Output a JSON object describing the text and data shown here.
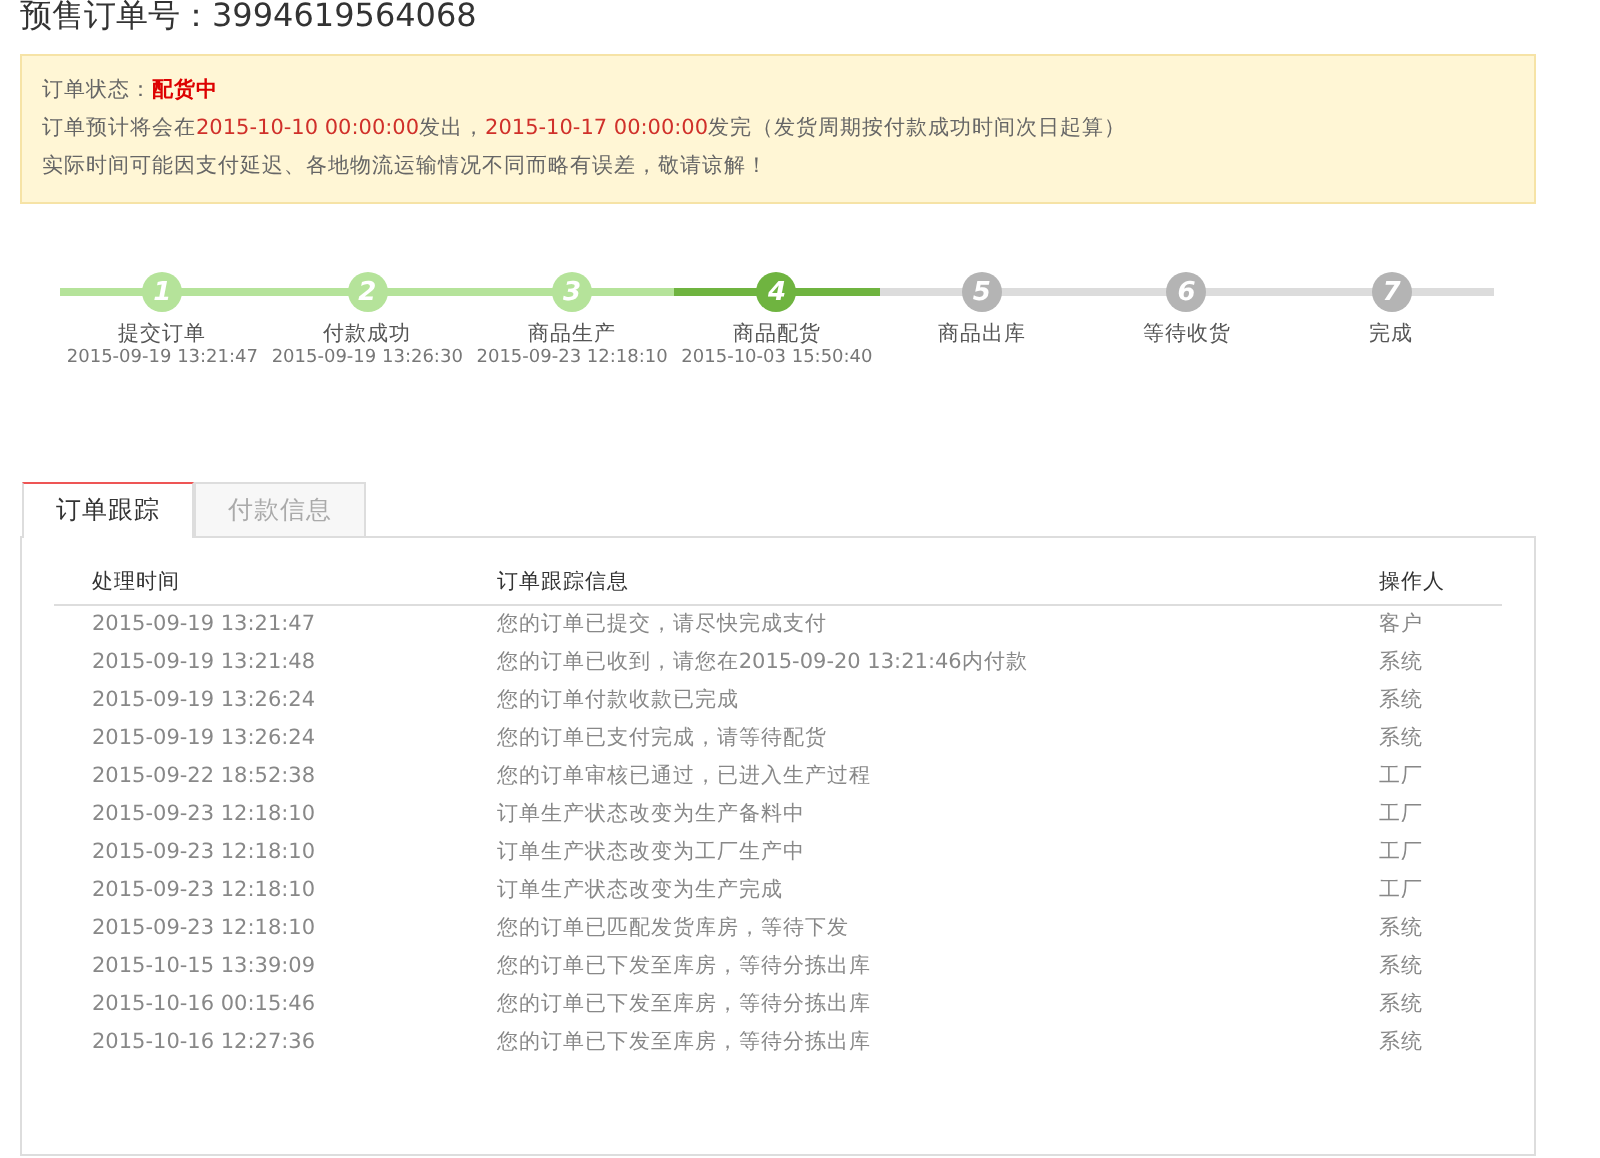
{
  "title": "预售订单号：3994619564068",
  "notice": {
    "status_label": "订单状态：",
    "status": "配货中",
    "schedule": [
      {
        "text": "订单预计将会在",
        "highlight": false
      },
      {
        "text": "2015-10-10 00:00:00",
        "highlight": true
      },
      {
        "text": "发出，",
        "highlight": false
      },
      {
        "text": "2015-10-17 00:00:00",
        "highlight": true
      },
      {
        "text": "发完（发货周期按付款成功时间次日起算）",
        "highlight": false
      }
    ],
    "disclaimer": "实际时间可能因支付延迟、各地物流运输情况不同而略有误差，敬请谅解！"
  },
  "steps": [
    {
      "number": "1",
      "label": "提交订单",
      "time": "2015-09-19 13:21:47",
      "completed": true,
      "current": false
    },
    {
      "number": "2",
      "label": "付款成功",
      "time": "2015-09-19 13:26:30",
      "completed": true,
      "current": false
    },
    {
      "number": "3",
      "label": "商品生产",
      "time": "2015-09-23 12:18:10",
      "completed": true,
      "current": false
    },
    {
      "number": "4",
      "label": "商品配货",
      "time": "2015-10-03 15:50:40",
      "completed": false,
      "current": true
    },
    {
      "number": "5",
      "label": "商品出库",
      "completed": false,
      "current": false
    },
    {
      "number": "6",
      "label": "等待收货",
      "completed": false,
      "current": false
    },
    {
      "number": "7",
      "label": "完成",
      "completed": false,
      "current": false
    }
  ],
  "tabs": [
    {
      "label": "订单跟踪",
      "selected": true
    },
    {
      "label": "付款信息",
      "selected": false
    }
  ],
  "table": {
    "columns": [
      "处理时间",
      "订单跟踪信息",
      "操作人"
    ],
    "rows": [
      [
        "2015-09-19 13:21:47",
        "您的订单已提交，请尽快完成支付",
        "客户"
      ],
      [
        "2015-09-19 13:21:48",
        "您的订单已收到，请您在2015-09-20 13:21:46内付款",
        "系统"
      ],
      [
        "2015-09-19 13:26:24",
        "您的订单付款收款已完成",
        "系统"
      ],
      [
        "2015-09-19 13:26:24",
        "您的订单已支付完成，请等待配货",
        "系统"
      ],
      [
        "2015-09-22 18:52:38",
        "您的订单审核已通过，已进入生产过程",
        "工厂"
      ],
      [
        "2015-09-23 12:18:10",
        "订单生产状态改变为生产备料中",
        "工厂"
      ],
      [
        "2015-09-23 12:18:10",
        "订单生产状态改变为工厂生产中",
        "工厂"
      ],
      [
        "2015-09-23 12:18:10",
        "订单生产状态改变为生产完成",
        "工厂"
      ],
      [
        "2015-09-23 12:18:10",
        "您的订单已匹配发货库房，等待下发",
        "系统"
      ],
      [
        "2015-10-15 13:39:09",
        "您的订单已下发至库房，等待分拣出库",
        "系统"
      ],
      [
        "2015-10-16 00:15:46",
        "您的订单已下发至库房，等待分拣出库",
        "系统"
      ],
      [
        "2015-10-16 12:27:36",
        "您的订单已下发至库房，等待分拣出库",
        "系统"
      ]
    ]
  }
}
